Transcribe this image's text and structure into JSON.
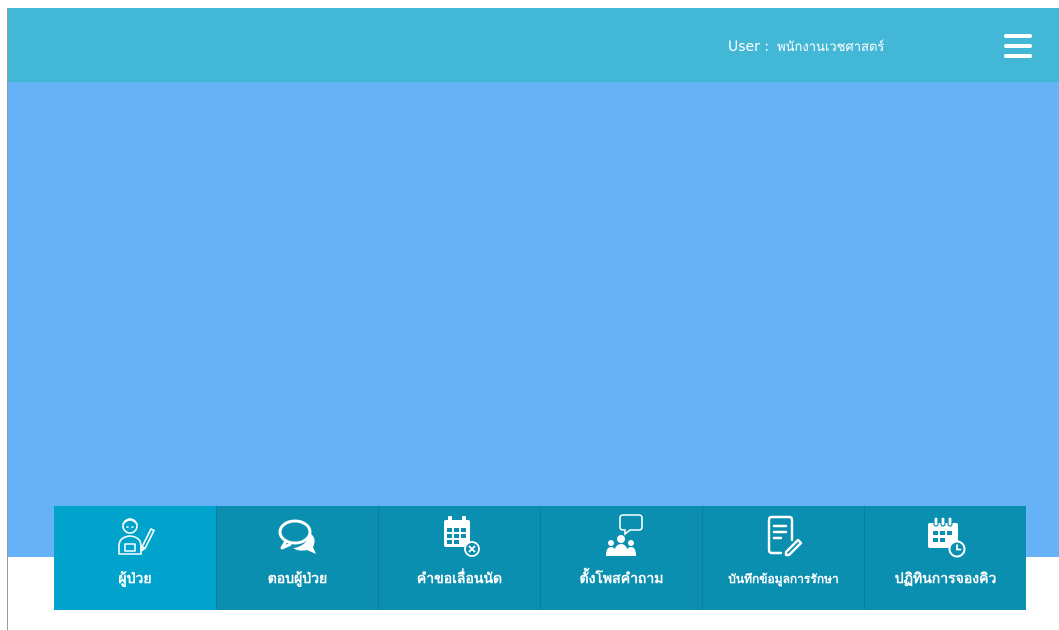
{
  "header": {
    "user_prefix": "User :",
    "user_name": "พนักงานเวชศาสตร์",
    "menu_icon": "hamburger-menu-icon"
  },
  "bottom_nav": {
    "items": [
      {
        "label": "ผู้ป่วย",
        "icon": "patient-icon",
        "active": true
      },
      {
        "label": "ตอบผู้ป่วย",
        "icon": "chat-bubbles-icon",
        "active": false
      },
      {
        "label": "คำขอเลื่อนนัด",
        "icon": "calendar-cancel-icon",
        "active": false
      },
      {
        "label": "ตั้งโพสคำถาม",
        "icon": "group-question-icon",
        "active": false
      },
      {
        "label": "บันทึกข้อมูลการรักษา",
        "icon": "document-edit-icon",
        "active": false
      },
      {
        "label": "ปฏิทินการจองคิว",
        "icon": "calendar-clock-icon",
        "active": false
      }
    ]
  },
  "colors": {
    "topbar": "#42b7d6",
    "main": "#66b2f6",
    "tile": "#0a8fb0",
    "tile_active": "#00a3cb"
  }
}
